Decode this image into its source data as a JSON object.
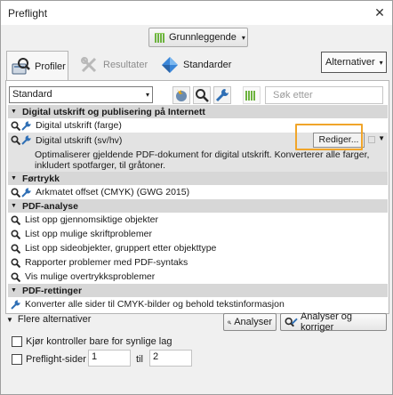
{
  "window": {
    "title": "Preflight",
    "close_glyph": "✕"
  },
  "mode": {
    "label": "Grunnleggende",
    "caret": "▾"
  },
  "tabs": [
    {
      "label": "Profiler",
      "icon": "profiles-icon",
      "state": "active"
    },
    {
      "label": "Resultater",
      "icon": "results-icon",
      "state": "disabled"
    },
    {
      "label": "Standarder",
      "icon": "standards-icon",
      "state": "normal"
    }
  ],
  "options_button": {
    "label": "Alternativer",
    "caret": "▾"
  },
  "filter": {
    "selected": "Standard",
    "caret": "▾",
    "search_placeholder": "Søk etter"
  },
  "list": {
    "categories": [
      {
        "label": "Digital utskrift og publisering på Internett",
        "items": [
          {
            "label": "Digital utskrift (farge)"
          },
          {
            "label": "Digital utskrift (sv/hv)",
            "selected": true,
            "edit_label": "Rediger...",
            "description": "Optimaliserer gjeldende PDF-dokument for digital utskrift. Konverterer alle farger, inkludert spotfarger, til gråtoner."
          }
        ]
      },
      {
        "label": "Førtrykk",
        "items": [
          {
            "label": "Arkmatet offset (CMYK) (GWG 2015)"
          }
        ]
      },
      {
        "label": "PDF-analyse",
        "items": [
          {
            "label": "List opp gjennomsiktige objekter"
          },
          {
            "label": "List opp mulige skriftproblemer"
          },
          {
            "label": "List opp sideobjekter, gruppert etter objekttype"
          },
          {
            "label": "Rapporter problemer med PDF-syntaks"
          },
          {
            "label": "Vis mulige overtrykksproblemer"
          }
        ]
      },
      {
        "label": "PDF-rettinger",
        "items": [
          {
            "label": "Konverter alle sider til CMYK-bilder og behold tekstinformasjon"
          }
        ]
      }
    ]
  },
  "footer": {
    "more_options": "Flere alternativer",
    "analyze": "Analyser",
    "analyze_fix": "Analyser og korriger",
    "visible_layers_only": "Kjør kontroller bare for synlige lag",
    "preflight_pages": "Preflight-sider",
    "page_from": "1",
    "page_to_label": "til",
    "page_to": "2"
  },
  "colors": {
    "highlight": "#f0a52a",
    "category_bg": "#d7d7d7",
    "selected_bg": "#e3e3e3",
    "green_bars": "#6db33f",
    "wrench": "#2f6fb5"
  }
}
